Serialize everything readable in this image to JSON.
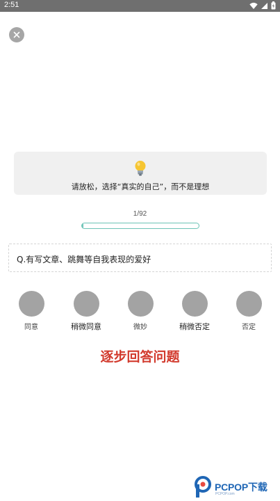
{
  "status_bar": {
    "time": "2:51",
    "icons": [
      "wifi-icon",
      "signal-icon",
      "battery-icon"
    ]
  },
  "tip": {
    "icon": "lightbulb-icon",
    "text": "请放松，选择“真实的自己”，而不是理想"
  },
  "progress": {
    "text": "1/92",
    "current": 1,
    "total": 92
  },
  "question": {
    "text": "Q.有写文章、跳舞等自我表现的爱好"
  },
  "options": [
    {
      "label": "同意"
    },
    {
      "label": "稍微同意"
    },
    {
      "label": "微妙"
    },
    {
      "label": "稍微否定"
    },
    {
      "label": "否定"
    }
  ],
  "banner": {
    "text": "逐步回答问题"
  },
  "watermark": {
    "brand": "PCPOP下载",
    "sub": "PCPOP.com"
  },
  "colors": {
    "status_bar": "#6f6f6f",
    "accent": "#6cc3b6",
    "banner": "#d23a2d",
    "option": "#a3a3a3"
  }
}
